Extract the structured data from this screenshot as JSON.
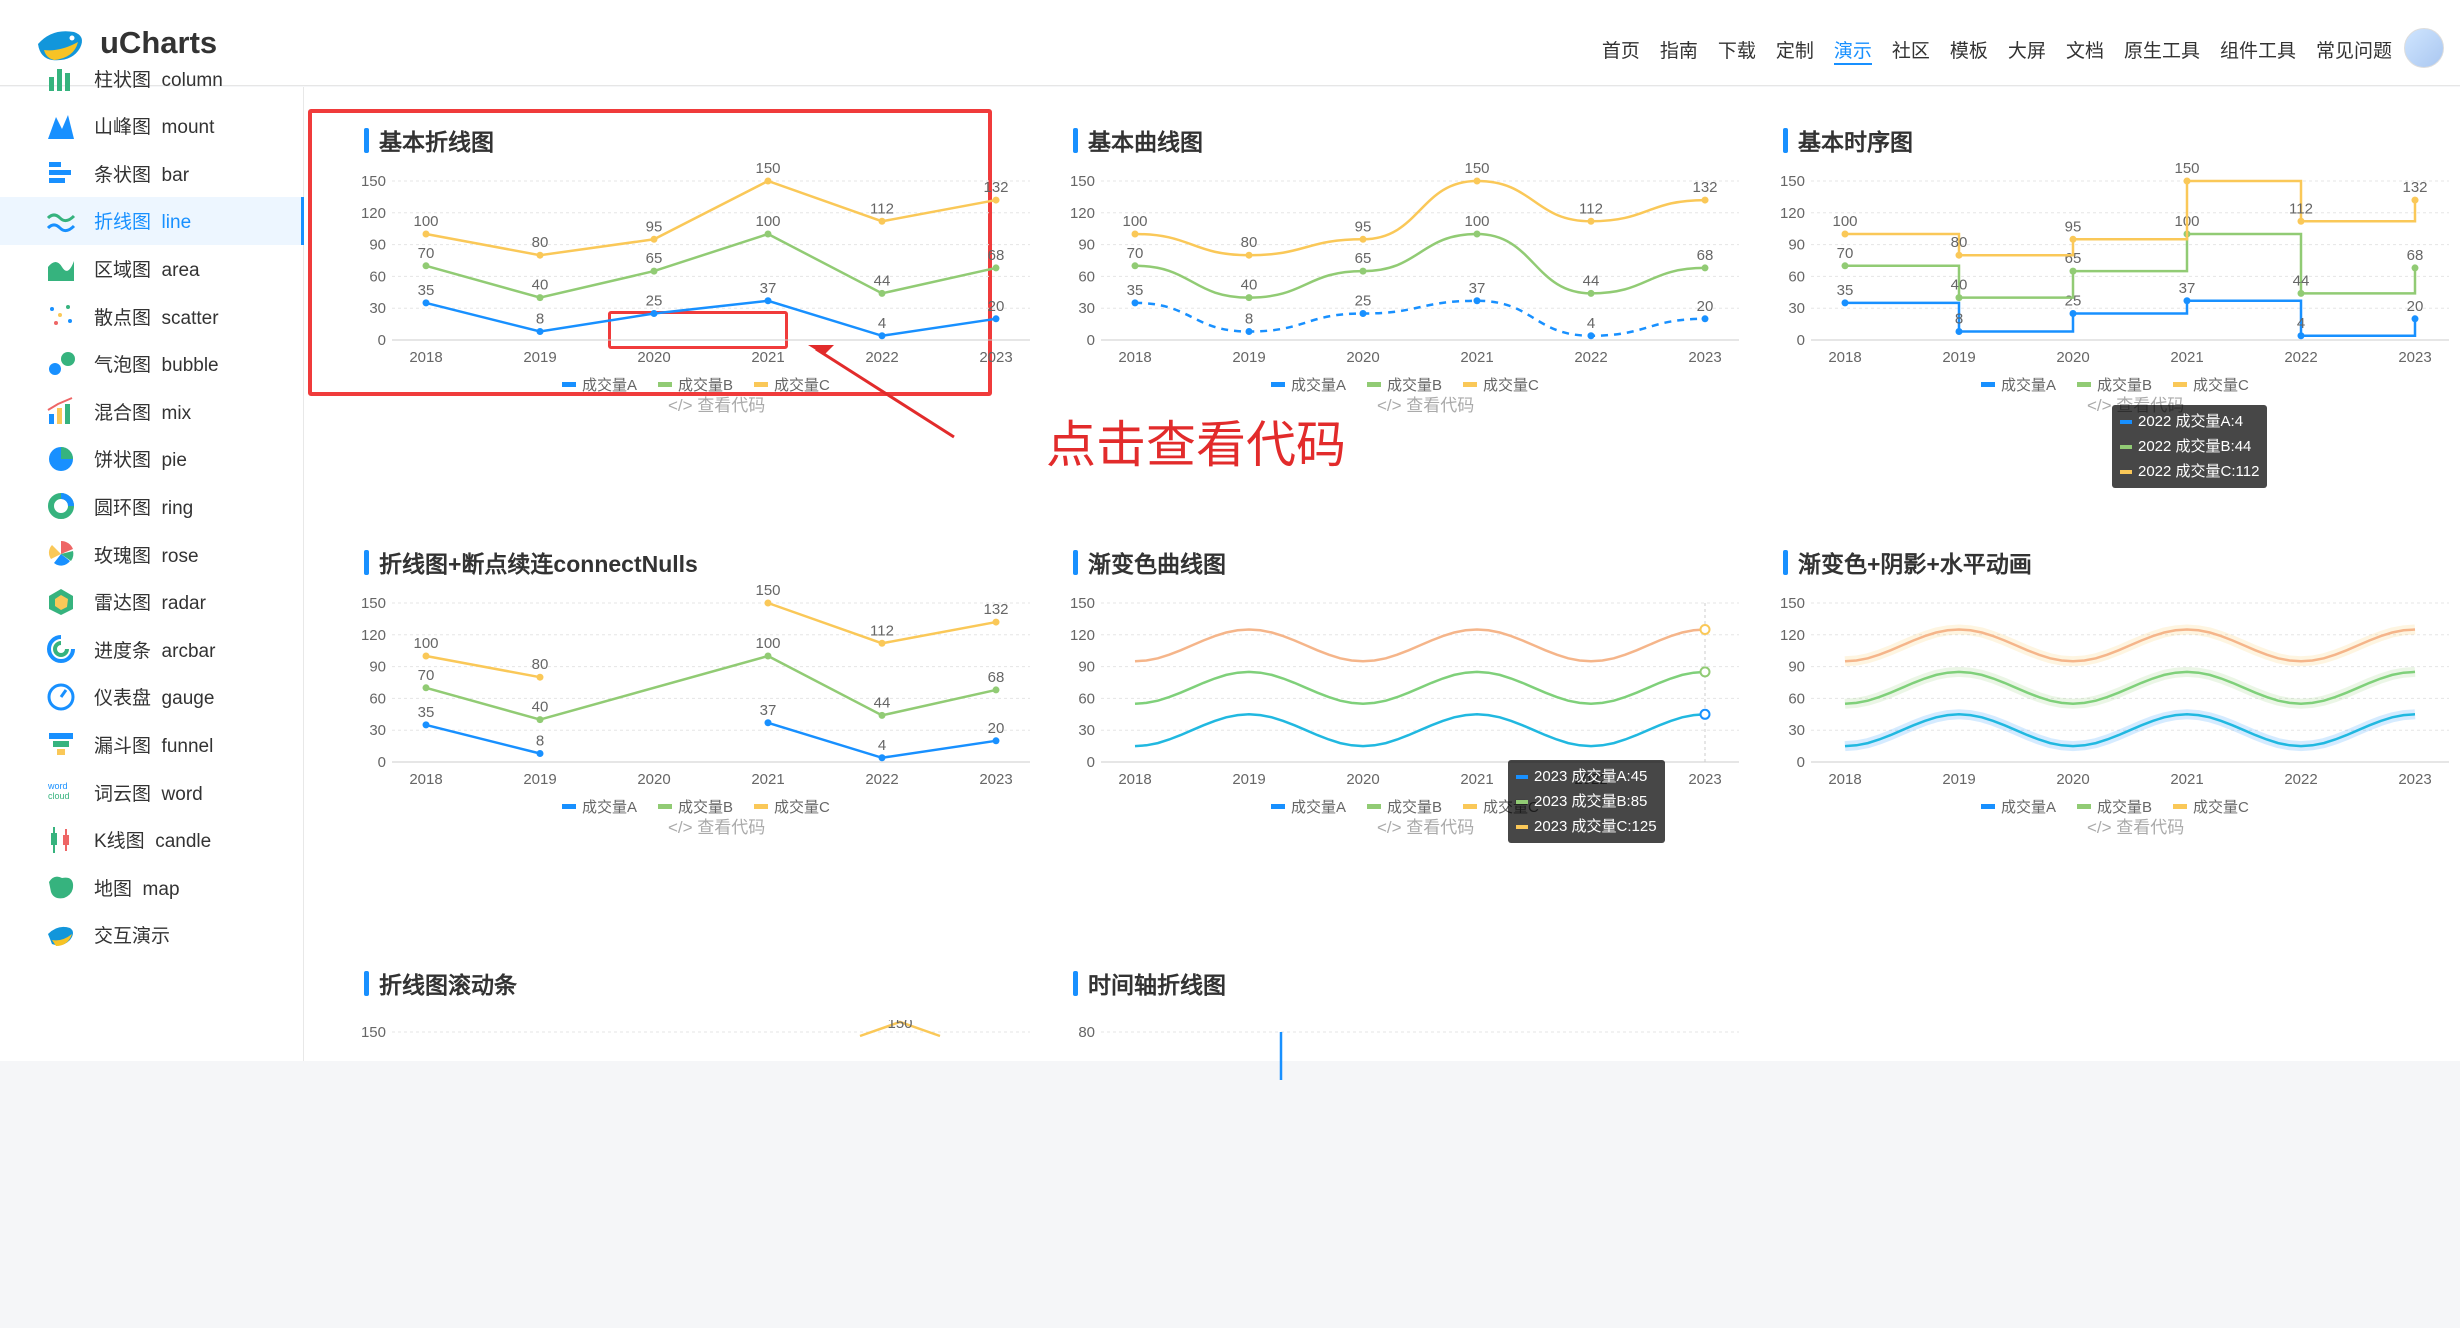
{
  "app": {
    "name": "uCharts"
  },
  "nav": [
    "首页",
    "指南",
    "下载",
    "定制",
    "演示",
    "社区",
    "模板",
    "大屏",
    "文档",
    "原生工具",
    "组件工具",
    "常见问题"
  ],
  "nav_active": "演示",
  "sidebar": [
    {
      "label": "柱状图  column",
      "icon": "column-chart-icon",
      "active": false
    },
    {
      "label": "山峰图  mount",
      "icon": "mount-chart-icon",
      "active": false
    },
    {
      "label": "条状图  bar",
      "icon": "bar-chart-icon",
      "active": false
    },
    {
      "label": "折线图  line",
      "icon": "line-chart-icon",
      "active": true
    },
    {
      "label": "区域图  area",
      "icon": "area-chart-icon",
      "active": false
    },
    {
      "label": "散点图  scatter",
      "icon": "scatter-chart-icon",
      "active": false
    },
    {
      "label": "气泡图  bubble",
      "icon": "bubble-chart-icon",
      "active": false
    },
    {
      "label": "混合图  mix",
      "icon": "mix-chart-icon",
      "active": false
    },
    {
      "label": "饼状图  pie",
      "icon": "pie-chart-icon",
      "active": false
    },
    {
      "label": "圆环图  ring",
      "icon": "ring-chart-icon",
      "active": false
    },
    {
      "label": "玫瑰图  rose",
      "icon": "rose-chart-icon",
      "active": false
    },
    {
      "label": "雷达图  radar",
      "icon": "radar-chart-icon",
      "active": false
    },
    {
      "label": "进度条  arcbar",
      "icon": "arcbar-chart-icon",
      "active": false
    },
    {
      "label": "仪表盘  gauge",
      "icon": "gauge-chart-icon",
      "active": false
    },
    {
      "label": "漏斗图  funnel",
      "icon": "funnel-chart-icon",
      "active": false
    },
    {
      "label": "词云图  word",
      "icon": "word-cloud-icon",
      "active": false
    },
    {
      "label": "K线图  candle",
      "icon": "candle-chart-icon",
      "active": false
    },
    {
      "label": "地图  map",
      "icon": "map-chart-icon",
      "active": false
    },
    {
      "label": "交互演示",
      "icon": "interactive-demo-icon",
      "active": false
    }
  ],
  "code_link": "</> 查看代码",
  "annotation_text": "点击查看代码",
  "colors": {
    "seriesA": "#1890FF",
    "seriesB": "#91CB74",
    "seriesC": "#FAC858",
    "accent": "#1890ff",
    "highlight": "#f03b3b"
  },
  "cards": [
    {
      "title": "基本折线图",
      "mode": "line"
    },
    {
      "title": "基本曲线图",
      "mode": "curve"
    },
    {
      "title": "基本时序图",
      "mode": "step"
    },
    {
      "title": "折线图+断点续连connectNulls",
      "mode": "nulls"
    },
    {
      "title": "渐变色曲线图",
      "mode": "wave"
    },
    {
      "title": "渐变色+阴影+水平动画",
      "mode": "wave-shadow"
    },
    {
      "title": "折线图滚动条",
      "mode": "partial"
    },
    {
      "title": "时间轴折线图",
      "mode": "partial"
    }
  ],
  "tooltips": [
    {
      "card": 2,
      "rows": [
        "2022 成交量A:4",
        "2022 成交量B:44",
        "2022 成交量C:112"
      ]
    },
    {
      "card": 4,
      "rows": [
        "2023 成交量A:45",
        "2023 成交量B:85",
        "2023 成交量C:125"
      ]
    }
  ],
  "partial_axis": {
    "scroll": "150",
    "timeline": "80"
  },
  "chart_data": [
    {
      "type": "line",
      "categories": [
        "2018",
        "2019",
        "2020",
        "2021",
        "2022",
        "2023"
      ],
      "ylim": [
        0,
        150
      ],
      "yticks": [
        0,
        30,
        60,
        90,
        120,
        150
      ],
      "series": [
        {
          "name": "成交量A",
          "values": [
            35,
            8,
            25,
            37,
            4,
            20
          ]
        },
        {
          "name": "成交量B",
          "values": [
            70,
            40,
            65,
            100,
            44,
            68
          ]
        },
        {
          "name": "成交量C",
          "values": [
            100,
            80,
            95,
            150,
            112,
            132
          ]
        }
      ],
      "title": "基本折线图"
    },
    {
      "type": "line",
      "categories": [
        "2018",
        "2019",
        "2020",
        "2021",
        "2022",
        "2023"
      ],
      "ylim": [
        0,
        150
      ],
      "yticks": [
        0,
        30,
        60,
        90,
        120,
        150
      ],
      "series": [
        {
          "name": "成交量A",
          "values": [
            35,
            8,
            25,
            37,
            4,
            20
          ]
        },
        {
          "name": "成交量B",
          "values": [
            70,
            40,
            65,
            100,
            44,
            68
          ]
        },
        {
          "name": "成交量C",
          "values": [
            100,
            80,
            95,
            150,
            112,
            132
          ]
        }
      ],
      "title": "基本曲线图"
    },
    {
      "type": "line",
      "categories": [
        "2018",
        "2019",
        "2020",
        "2021",
        "2022",
        "2023"
      ],
      "ylim": [
        0,
        150
      ],
      "yticks": [
        0,
        30,
        60,
        90,
        120,
        150
      ],
      "series": [
        {
          "name": "成交量A",
          "values": [
            35,
            8,
            25,
            37,
            4,
            20
          ]
        },
        {
          "name": "成交量B",
          "values": [
            70,
            40,
            65,
            100,
            44,
            68
          ]
        },
        {
          "name": "成交量C",
          "values": [
            100,
            80,
            95,
            150,
            112,
            132
          ]
        }
      ],
      "title": "基本时序图"
    },
    {
      "type": "line",
      "categories": [
        "2018",
        "2019",
        "2020",
        "2021",
        "2022",
        "2023"
      ],
      "ylim": [
        0,
        150
      ],
      "yticks": [
        0,
        30,
        60,
        90,
        120,
        150
      ],
      "series": [
        {
          "name": "成交量A",
          "values": [
            35,
            8,
            null,
            37,
            4,
            20
          ]
        },
        {
          "name": "成交量B",
          "values": [
            70,
            40,
            null,
            100,
            44,
            68
          ]
        },
        {
          "name": "成交量C",
          "values": [
            100,
            80,
            null,
            150,
            112,
            132
          ]
        }
      ],
      "title": "折线图+断点续连connectNulls"
    },
    {
      "type": "line",
      "categories": [
        "2018",
        "2019",
        "2020",
        "2021",
        "2022",
        "2023"
      ],
      "ylim": [
        0,
        150
      ],
      "yticks": [
        0,
        30,
        60,
        90,
        120,
        150
      ],
      "series": [
        {
          "name": "成交量A",
          "values": [
            15,
            45,
            15,
            45,
            15,
            45
          ]
        },
        {
          "name": "成交量B",
          "values": [
            55,
            85,
            55,
            85,
            55,
            85
          ]
        },
        {
          "name": "成交量C",
          "values": [
            95,
            125,
            95,
            125,
            95,
            125
          ]
        }
      ],
      "title": "渐变色曲线图"
    },
    {
      "type": "line",
      "categories": [
        "2018",
        "2019",
        "2020",
        "2021",
        "2022",
        "2023"
      ],
      "ylim": [
        0,
        150
      ],
      "yticks": [
        0,
        30,
        60,
        90,
        120,
        150
      ],
      "series": [
        {
          "name": "成交量A",
          "values": [
            15,
            45,
            15,
            45,
            15,
            45
          ]
        },
        {
          "name": "成交量B",
          "values": [
            55,
            85,
            55,
            85,
            55,
            85
          ]
        },
        {
          "name": "成交量C",
          "values": [
            95,
            125,
            95,
            125,
            95,
            125
          ]
        }
      ],
      "title": "渐变色+阴影+水平动画"
    }
  ]
}
